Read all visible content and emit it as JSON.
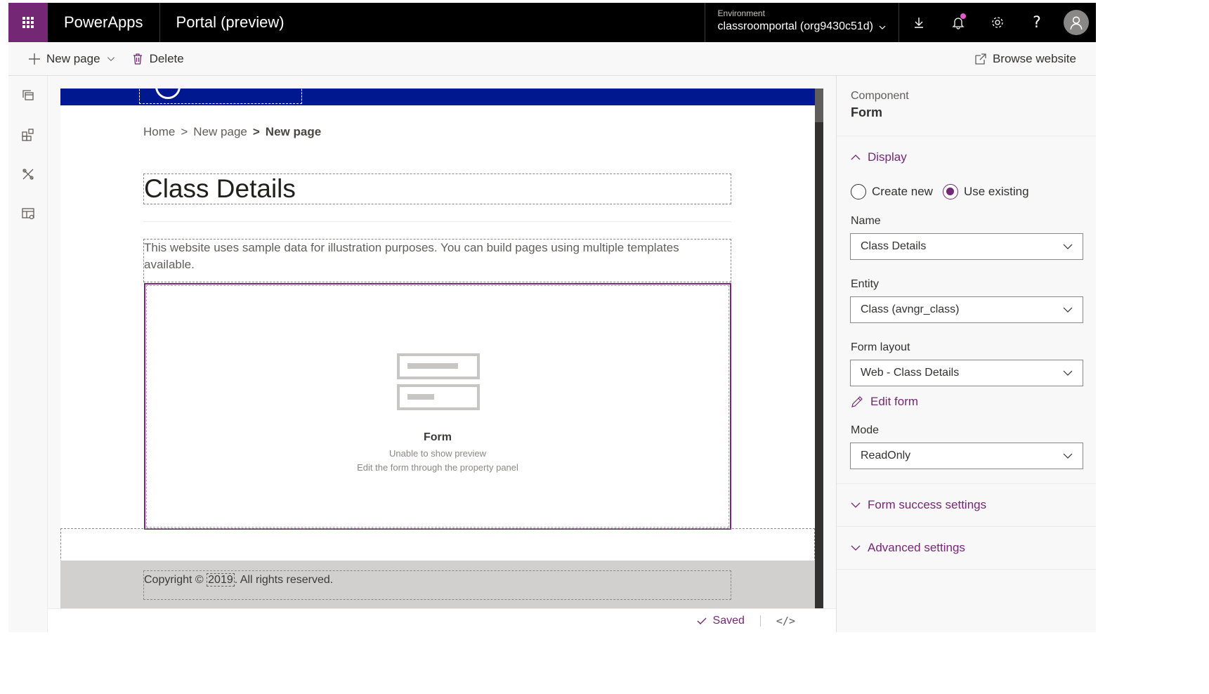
{
  "topbar": {
    "app_name": "PowerApps",
    "portal_name": "Portal (preview)",
    "environment_label": "Environment",
    "environment_value": "classroomportal (org9430c51d)"
  },
  "commandbar": {
    "new_page": "New page",
    "delete": "Delete",
    "browse_website": "Browse website"
  },
  "canvas": {
    "breadcrumb": [
      "Home",
      ">",
      "New page",
      ">",
      "New page"
    ],
    "page_title": "Class Details",
    "description": "This website uses sample data for illustration purposes. You can build pages using multiple templates available.",
    "form_placeholder": {
      "label": "Form",
      "line1": "Unable to show preview",
      "line2": "Edit the form through the property panel"
    },
    "footer": {
      "prefix": "Copyright © ",
      "year": "2019",
      "suffix": ". All rights reserved."
    }
  },
  "statusbar": {
    "saved": "Saved",
    "code": "</>"
  },
  "panel": {
    "caption": "Component",
    "title": "Form",
    "display_section": "Display",
    "radio_create": "Create new",
    "radio_existing": "Use existing",
    "selected_radio": "Use existing",
    "name_label": "Name",
    "name_value": "Class Details",
    "entity_label": "Entity",
    "entity_value": "Class (avngr_class)",
    "layout_label": "Form layout",
    "layout_value": "Web - Class Details",
    "edit_form": "Edit form",
    "mode_label": "Mode",
    "mode_value": "ReadOnly",
    "success_section": "Form success settings",
    "advanced_section": "Advanced settings"
  },
  "colors": {
    "accent": "#742774",
    "site_header": "#00188f",
    "topbar": "#000000"
  }
}
